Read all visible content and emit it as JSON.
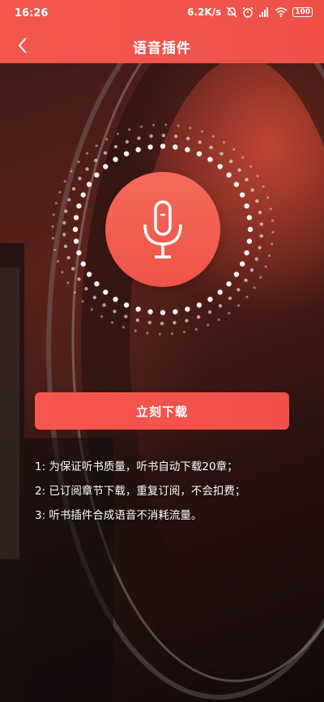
{
  "status_bar": {
    "time": "16:26",
    "network_speed": "6.2K/s",
    "battery": "100",
    "icons": [
      "mute-icon",
      "alarm-icon",
      "signal-icon",
      "wifi-icon",
      "battery-icon"
    ]
  },
  "nav": {
    "title": "语音插件",
    "back_icon": "chevron-left-icon"
  },
  "mic": {
    "icon": "microphone-icon"
  },
  "download_button": {
    "label": "立刻下载"
  },
  "notes": [
    "1: 为保证听书质量，听书自动下载20章；",
    "2: 已订阅章节下载，重复订阅，不会扣费；",
    "3: 听书插件合成语音不消耗流量。"
  ],
  "colors": {
    "accent": "#f2564d",
    "text_on_accent": "#ffffff"
  }
}
